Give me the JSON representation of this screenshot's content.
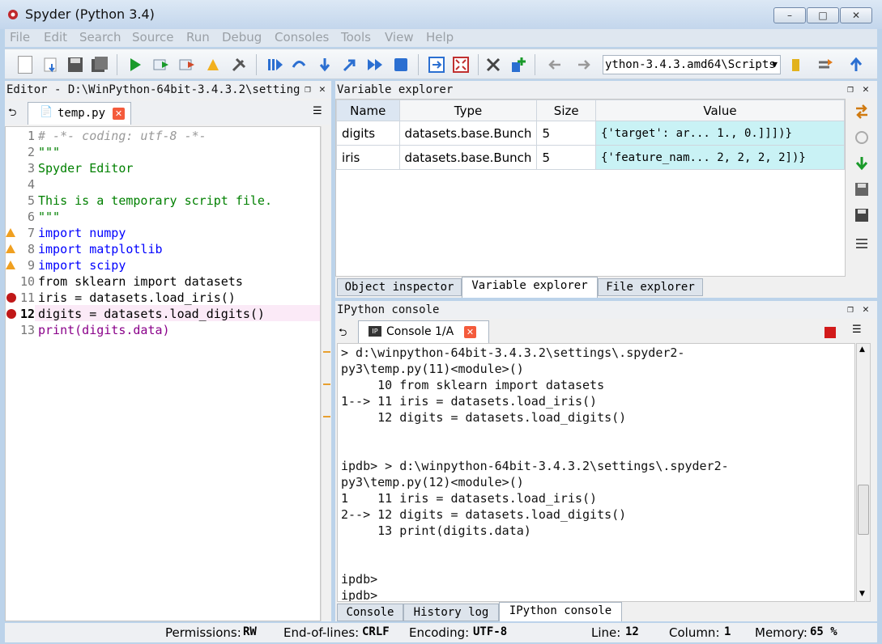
{
  "window": {
    "title": "Spyder (Python 3.4)"
  },
  "menu": [
    "File",
    "Edit",
    "Search",
    "Source",
    "Run",
    "Debug",
    "Consoles",
    "Tools",
    "View",
    "Help"
  ],
  "toolbar": {
    "working_dir": "​ython-3.4.3.amd64\\Scripts"
  },
  "editor": {
    "header": "Editor - D:\\WinPython-64bit-3.4.3.2\\setting",
    "tab": "temp.py",
    "lines": [
      {
        "n": "1",
        "t": "# -*- coding: utf-8 -*-"
      },
      {
        "n": "2",
        "t": "\"\"\""
      },
      {
        "n": "3",
        "t": "Spyder Editor"
      },
      {
        "n": "4",
        "t": ""
      },
      {
        "n": "5",
        "t": "This is a temporary script file."
      },
      {
        "n": "6",
        "t": "\"\"\""
      },
      {
        "n": "7",
        "t": "import numpy"
      },
      {
        "n": "8",
        "t": "import matplotlib"
      },
      {
        "n": "9",
        "t": "import scipy"
      },
      {
        "n": "10",
        "t": "from sklearn import datasets"
      },
      {
        "n": "11",
        "t": "iris = datasets.load_iris()"
      },
      {
        "n": "12",
        "t": "digits = datasets.load_digits()"
      },
      {
        "n": "13",
        "t": "print(digits.data)"
      }
    ]
  },
  "variable_explorer": {
    "header": "Variable explorer",
    "columns": [
      "Name",
      "Type",
      "Size",
      "Value"
    ],
    "rows": [
      {
        "name": "digits",
        "type": "datasets.base.Bunch",
        "size": "5",
        "value": "{'target': ar... 1.,   0.]]])}"
      },
      {
        "name": "iris",
        "type": "datasets.base.Bunch",
        "size": "5",
        "value": "{'feature_nam... 2, 2, 2, 2])}"
      }
    ],
    "tabs": [
      "Object inspector",
      "Variable explorer",
      "File explorer"
    ]
  },
  "ipython": {
    "header": "IPython console",
    "tab": "Console 1/A",
    "lines": [
      "> d:\\winpython-64bit-3.4.3.2\\settings\\.spyder2-",
      "py3\\temp.py(11)<module>()",
      "     10 from sklearn import datasets",
      "1--> 11 iris = datasets.load_iris()",
      "     12 digits = datasets.load_digits()",
      "",
      "",
      "ipdb> > d:\\winpython-64bit-3.4.3.2\\settings\\.spyder2-",
      "py3\\temp.py(12)<module>()",
      "1    11 iris = datasets.load_iris()",
      "2--> 12 digits = datasets.load_digits()",
      "     13 print(digits.data)",
      "",
      "",
      "ipdb>",
      "ipdb>"
    ],
    "tabs": [
      "Console",
      "History log",
      "IPython console"
    ]
  },
  "status": {
    "perm_label": "Permissions:",
    "perm": "RW",
    "eol_label": "End-of-lines:",
    "eol": "CRLF",
    "enc_label": "Encoding:",
    "enc": "UTF-8",
    "line_label": "Line:",
    "line": "12",
    "col_label": "Column:",
    "col": "1",
    "mem_label": "Memory:",
    "mem": "65 %"
  }
}
